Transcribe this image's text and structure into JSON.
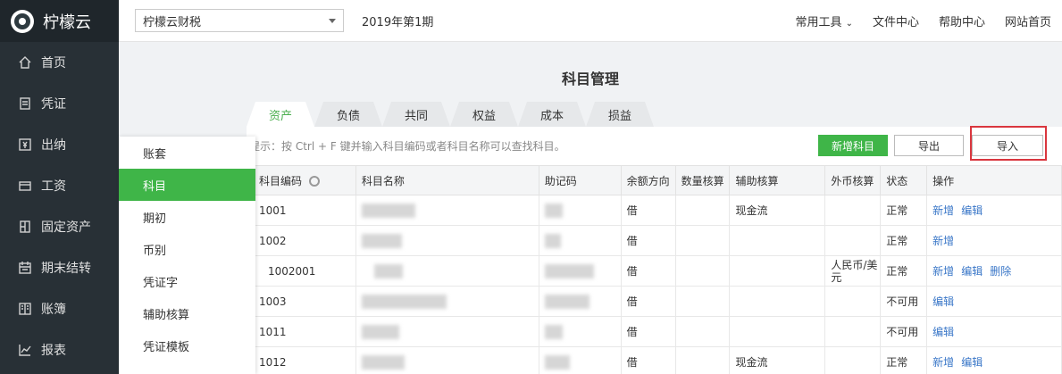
{
  "app": {
    "name": "柠檬云"
  },
  "nav": {
    "items": [
      {
        "label": "首页",
        "icon": "home-icon"
      },
      {
        "label": "凭证",
        "icon": "voucher-icon"
      },
      {
        "label": "出纳",
        "icon": "cashier-icon"
      },
      {
        "label": "工资",
        "icon": "salary-icon"
      },
      {
        "label": "固定资产",
        "icon": "asset-icon"
      },
      {
        "label": "期末结转",
        "icon": "calendar-icon"
      },
      {
        "label": "账簿",
        "icon": "book-icon"
      },
      {
        "label": "报表",
        "icon": "chart-icon"
      }
    ]
  },
  "topbar": {
    "company": "柠檬云财税",
    "period": "2019年第1期",
    "links": {
      "tools": "常用工具",
      "files": "文件中心",
      "help": "帮助中心",
      "site": "网站首页"
    }
  },
  "page": {
    "title": "科目管理"
  },
  "tabs": [
    "资产",
    "负债",
    "共同",
    "权益",
    "成本",
    "损益"
  ],
  "toolbar": {
    "tip": "提示：按 Ctrl + F 键并输入科目编码或者科目名称可以查找科目。",
    "add": "新增科目",
    "export": "导出",
    "import": "导入"
  },
  "submenu": {
    "items": [
      "账套",
      "科目",
      "期初",
      "币别",
      "凭证字",
      "辅助核算",
      "凭证模板"
    ],
    "active": "科目"
  },
  "table": {
    "headers": [
      "科目编码",
      "科目名称",
      "助记码",
      "余额方向",
      "数量核算",
      "辅助核算",
      "外币核算",
      "状态",
      "操作"
    ],
    "rows": [
      {
        "code": "1001",
        "direction": "借",
        "aux": "现金流",
        "currency": "",
        "status": "正常",
        "ops": [
          "新增",
          "编辑"
        ]
      },
      {
        "code": "1002",
        "direction": "借",
        "aux": "",
        "currency": "",
        "status": "正常",
        "ops": [
          "新增"
        ]
      },
      {
        "code": "1002001",
        "direction": "借",
        "aux": "",
        "currency": "人民币/美元",
        "status": "正常",
        "ops": [
          "新增",
          "编辑",
          "删除"
        ]
      },
      {
        "code": "1003",
        "direction": "借",
        "aux": "",
        "currency": "",
        "status": "不可用",
        "ops": [
          "编辑"
        ]
      },
      {
        "code": "1011",
        "direction": "借",
        "aux": "",
        "currency": "",
        "status": "不可用",
        "ops": [
          "编辑"
        ]
      },
      {
        "code": "1012",
        "direction": "借",
        "aux": "现金流",
        "currency": "",
        "status": "正常",
        "ops": [
          "新增",
          "编辑"
        ]
      }
    ]
  }
}
